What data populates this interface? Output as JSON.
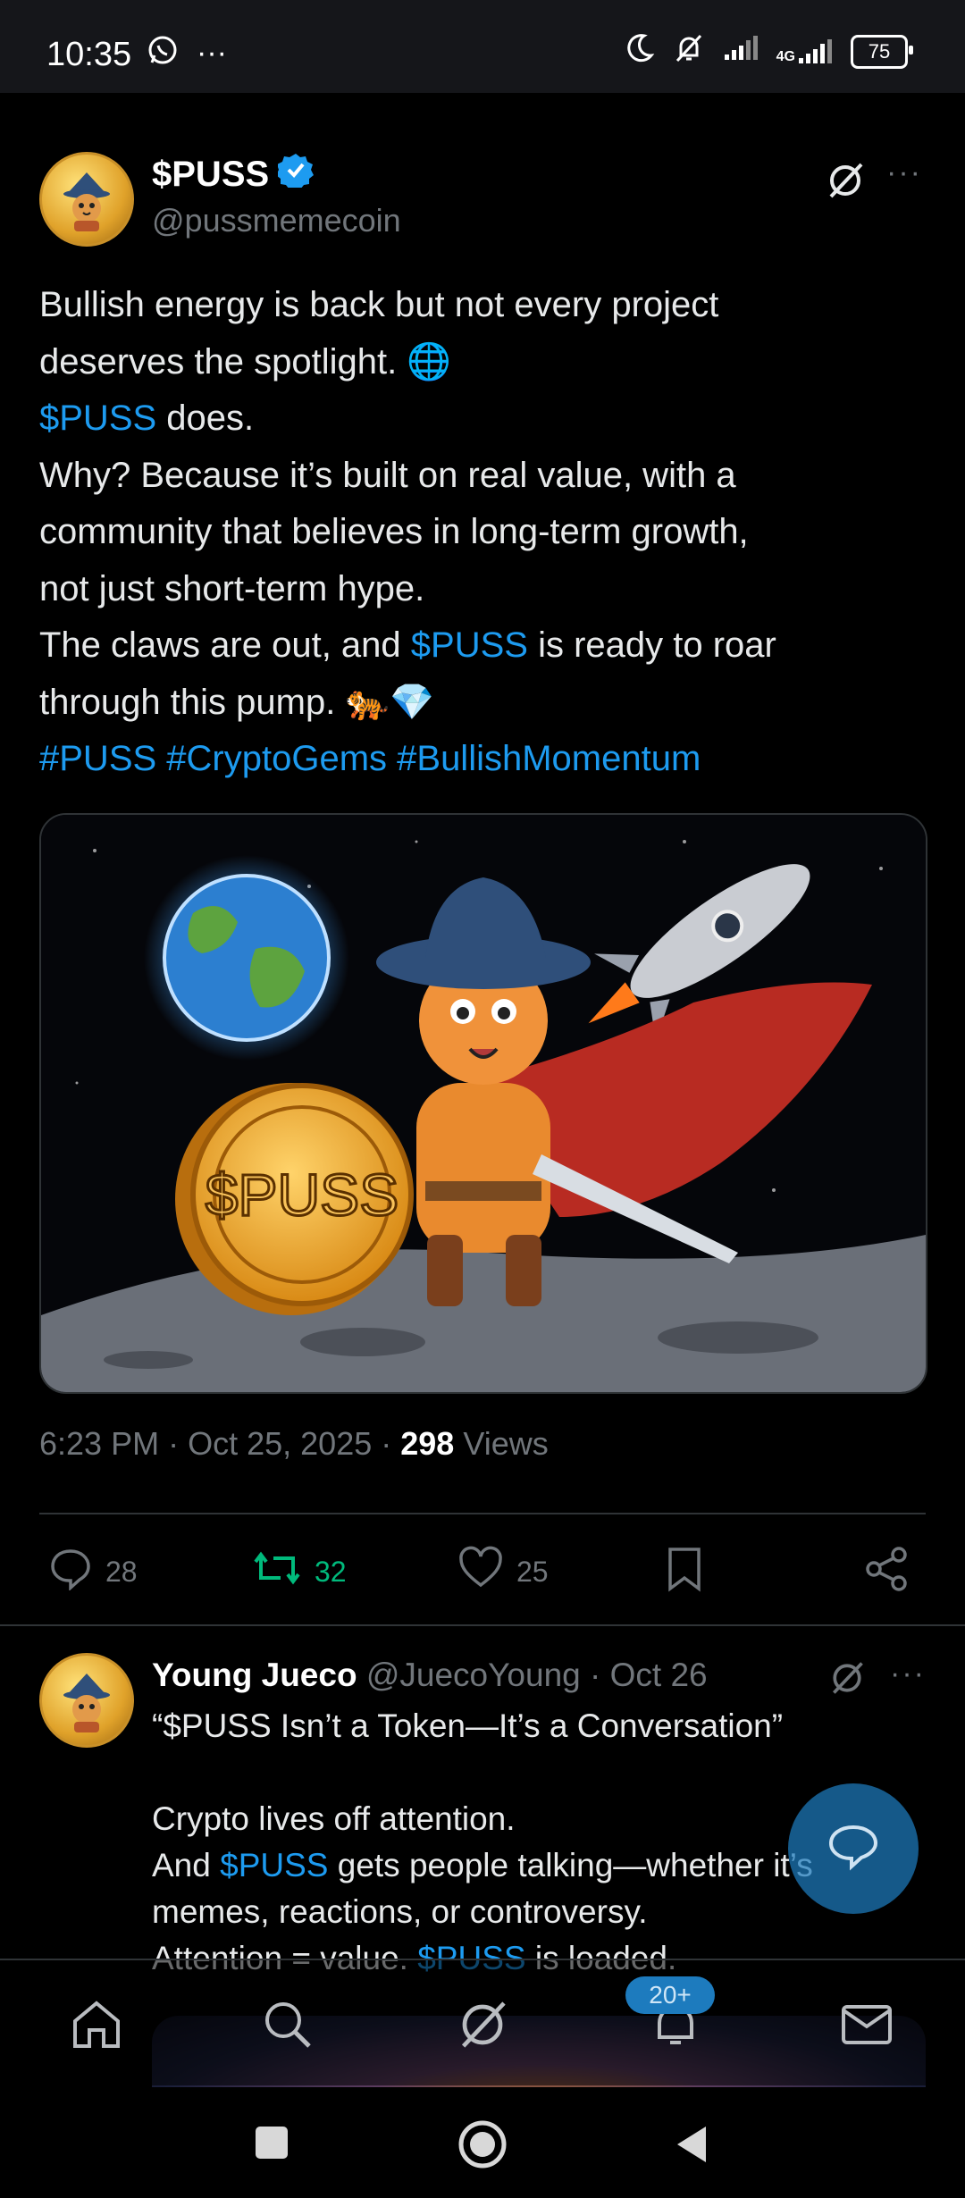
{
  "status_bar": {
    "time": "10:35",
    "battery": "75",
    "network": "4G"
  },
  "post": {
    "author_name": "$PUSS",
    "author_handle": "@pussmemecoin",
    "verified": true,
    "text_lines": [
      [
        {
          "t": "Bullish energy is back  but not every project"
        }
      ],
      [
        {
          "t": "deserves the spotlight. "
        },
        {
          "t": "🌐"
        }
      ],
      [
        {
          "t": "$PUSS",
          "link": true
        },
        {
          "t": " does."
        }
      ],
      [
        {
          "t": "Why? Because it’s built on real value, with a"
        }
      ],
      [
        {
          "t": "community that believes in long-term growth,"
        }
      ],
      [
        {
          "t": "not just short-term hype."
        }
      ],
      [
        {
          "t": "The claws are out, and "
        },
        {
          "t": "$PUSS",
          "link": true
        },
        {
          "t": " is ready to roar"
        }
      ],
      [
        {
          "t": "through this pump. "
        },
        {
          "t": "🐅💎"
        }
      ],
      [
        {
          "t": "#PUSS #CryptoGems #BullishMomentum",
          "link": true
        }
      ]
    ],
    "image_coin_text": "$PUSS",
    "time": "6:23 PM",
    "date": "Oct 25, 2025",
    "views_count": "298",
    "views_label": "Views",
    "replies": "28",
    "reposts": "32",
    "likes": "25"
  },
  "reply": {
    "name": "Young Jueco",
    "handle": "@JuecoYoung",
    "date": "Oct 26",
    "text_lines": [
      [
        {
          "t": "“$PUSS Isn’t a Token—It’s a Conversation”"
        }
      ],
      [
        {
          "t": ""
        }
      ],
      [
        {
          "t": "Crypto lives off attention."
        }
      ],
      [
        {
          "t": "And "
        },
        {
          "t": "$PUSS",
          "link": true
        },
        {
          "t": " gets people talking—whether it’s"
        }
      ],
      [
        {
          "t": "memes, reactions, or controversy."
        }
      ],
      [
        {
          "t": "Attention = value. "
        },
        {
          "t": "$PUSS",
          "link": true
        },
        {
          "t": " is loaded."
        }
      ]
    ]
  },
  "bottom_nav": {
    "items": [
      "home-icon",
      "search-icon",
      "grok-icon",
      "notifications-icon",
      "messages-icon"
    ],
    "notification_badge": "20+"
  },
  "colors": {
    "accent": "#1d9bf0",
    "repost_active": "#00ba7c",
    "muted": "#71767b",
    "background": "#000000"
  }
}
